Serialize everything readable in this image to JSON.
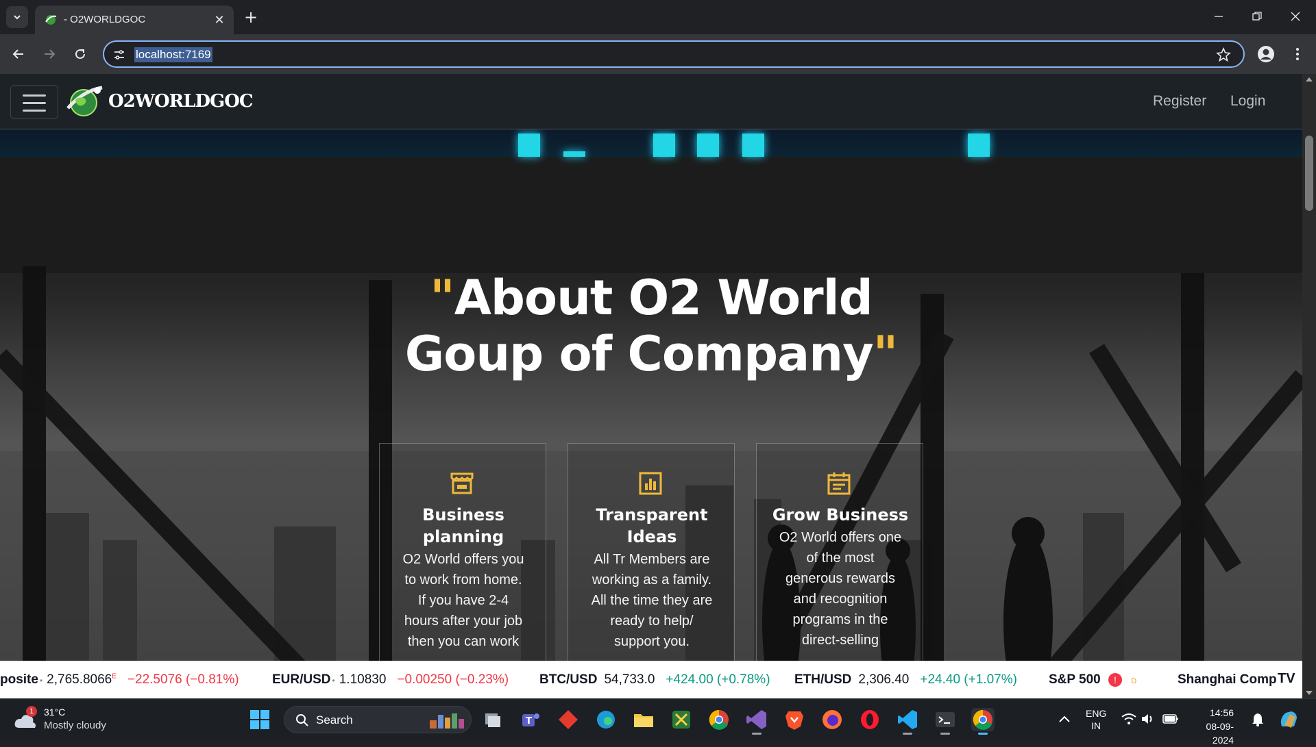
{
  "browser": {
    "tab_title": "- O2WORLDGOC",
    "new_tab_symbol": "+",
    "url": "localhost:7169"
  },
  "site": {
    "brand": "O2WORLDGOC",
    "nav": {
      "register": "Register",
      "login": "Login"
    },
    "hero": {
      "headline_line1": "About O2 World",
      "headline_line2": "Goup of Company",
      "open_quote": "\"",
      "close_quote": "\"",
      "accent_color": "#f0b83a"
    },
    "cards": [
      {
        "icon": "store-icon",
        "title_lines": [
          "Business",
          "planning"
        ],
        "body_lines": [
          "O2 World offers you",
          "to work from home.",
          "If you have 2-4",
          "hours after your job",
          "then you can work"
        ]
      },
      {
        "icon": "bar-chart-icon",
        "title_lines": [
          "Transparent",
          "Ideas"
        ],
        "body_lines": [
          "All Tr Members are",
          "working as a family.",
          "All the time they are",
          "ready to help/",
          "support you."
        ]
      },
      {
        "icon": "calendar-icon",
        "title_lines": [
          "Grow Business"
        ],
        "body_lines": [
          "O2 World offers one",
          "of the most",
          "generous rewards",
          "and recognition",
          "programs in the",
          "direct-selling"
        ]
      }
    ]
  },
  "market_ticker": [
    {
      "symbol": "posite",
      "marker": "•",
      "price": "2,765.8066",
      "flag": "E",
      "change": "−22.5076 (−0.81%)",
      "direction": "down"
    },
    {
      "symbol": "EUR/USD",
      "marker": "•",
      "price": "1.10830",
      "change": "−0.00250 (−0.23%)",
      "direction": "down"
    },
    {
      "symbol": "BTC/USD",
      "price": "54,733.0",
      "change": "+424.00 (+0.78%)",
      "direction": "up"
    },
    {
      "symbol": "ETH/USD",
      "price": "2,306.40",
      "change": "+24.40 (+1.07%)",
      "direction": "up"
    },
    {
      "symbol": "S&P 500",
      "alert": "!",
      "flag": "D"
    },
    {
      "symbol": "Shanghai Comp"
    }
  ],
  "ticker_brand": "TV",
  "taskbar": {
    "weather_badge": "1",
    "temperature": "31°C",
    "condition": "Mostly cloudy",
    "search_label": "Search",
    "language_line1": "ENG",
    "language_line2": "IN",
    "time": "14:56",
    "date": "08-09-2024"
  }
}
